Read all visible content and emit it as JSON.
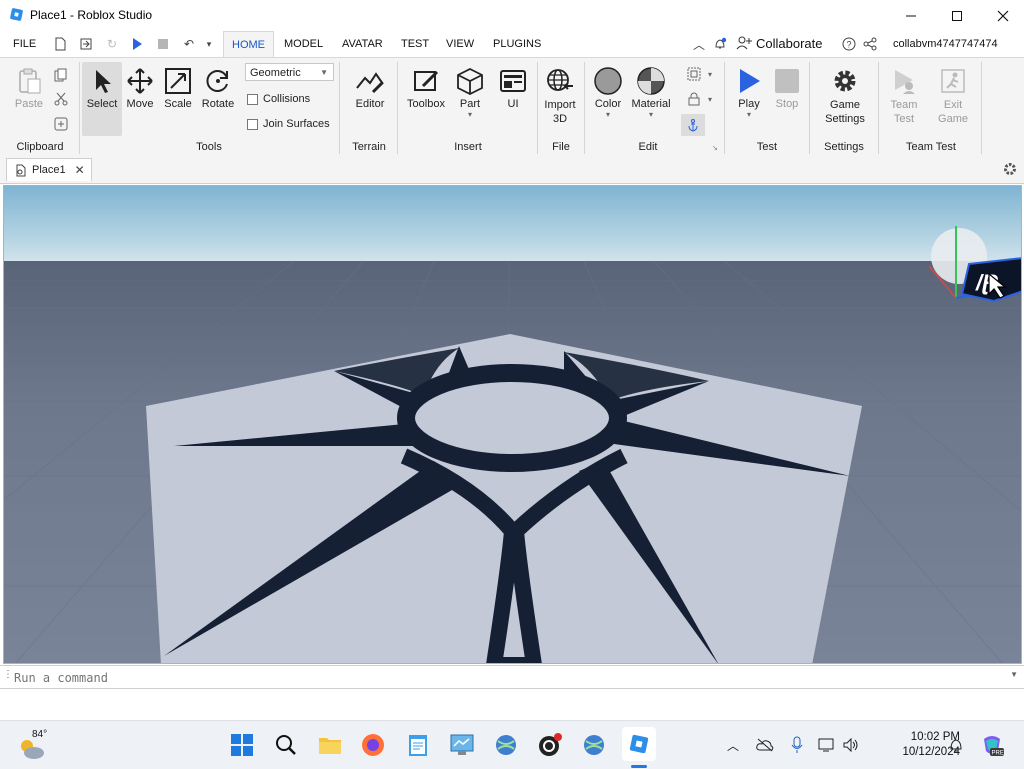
{
  "window": {
    "title": "Place1 - Roblox Studio",
    "controls": [
      "minimize",
      "maximize",
      "close"
    ]
  },
  "menu": {
    "file": "FILE",
    "tabs": [
      "HOME",
      "MODEL",
      "AVATAR",
      "TEST",
      "VIEW",
      "PLUGINS"
    ],
    "active_tab": "HOME",
    "collaborate": "Collaborate",
    "username": "collabvm4747747474"
  },
  "ribbon": {
    "clipboard": {
      "paste": "Paste",
      "group": "Clipboard"
    },
    "tools": {
      "select": "Select",
      "move": "Move",
      "scale": "Scale",
      "rotate": "Rotate",
      "mode_select": "Geometric",
      "collisions": "Collisions",
      "join_surfaces": "Join Surfaces",
      "group": "Tools"
    },
    "terrain": {
      "editor": "Editor",
      "group": "Terrain"
    },
    "insert": {
      "toolbox": "Toolbox",
      "part": "Part",
      "ui": "UI",
      "group": "Insert"
    },
    "file": {
      "import3d_line1": "Import",
      "import3d_line2": "3D",
      "group": "File"
    },
    "edit": {
      "color": "Color",
      "material": "Material",
      "group": "Edit"
    },
    "test": {
      "play": "Play",
      "stop": "Stop",
      "group": "Test"
    },
    "settings": {
      "game_settings_line1": "Game",
      "game_settings_line2": "Settings",
      "group": "Settings"
    },
    "team_test": {
      "team_test_line1": "Team",
      "team_test_line2": "Test",
      "exit_game_line1": "Exit",
      "exit_game_line2": "Game",
      "group": "Team Test"
    }
  },
  "doc_tab": {
    "label": "Place1"
  },
  "command_bar": {
    "placeholder": "Run a command"
  },
  "taskbar": {
    "weather_temp": "84°",
    "time": "10:02 PM",
    "date": "10/12/2024"
  },
  "colors": {
    "accent": "#1a56c4",
    "play_blue": "#2a62e0",
    "sky_top": "#7fb4d2",
    "baseplate": "#6b7689",
    "decal_plate": "#c3c9d6",
    "decal_mark": "#162034"
  }
}
